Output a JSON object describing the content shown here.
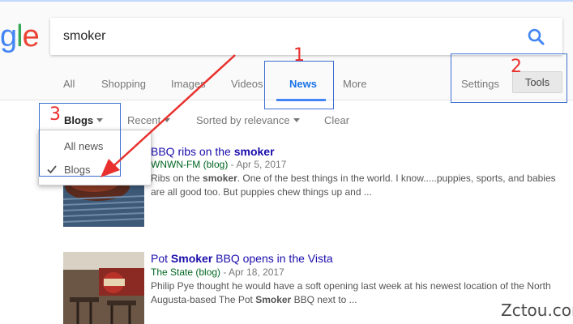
{
  "search": {
    "query": "smoker"
  },
  "logo_letters": {
    "g": "g",
    "l": "l",
    "e": "e"
  },
  "tabs": [
    {
      "label": "All"
    },
    {
      "label": "Shopping"
    },
    {
      "label": "Images"
    },
    {
      "label": "Videos"
    },
    {
      "label": "News"
    },
    {
      "label": "More"
    }
  ],
  "right_controls": {
    "settings": "Settings",
    "tools": "Tools"
  },
  "tools_bar": {
    "type": "Blogs",
    "time": "Recent",
    "sort": "Sorted by relevance",
    "clear": "Clear"
  },
  "type_dropdown": {
    "options": [
      "All news",
      "Blogs"
    ],
    "selected": "Blogs"
  },
  "results": [
    {
      "title_pre": "BBQ ribs on the ",
      "title_bold": "smoker",
      "title_post": "",
      "source": "WNWN-FM (blog)",
      "date": " - Apr 5, 2017",
      "snippet_1": "Ribs on the ",
      "snippet_bold": "smoker",
      "snippet_2": ". One of the best things in the world. I know.....puppies, sports, and babies are all good too. But puppies chew things up and ..."
    },
    {
      "title_pre": "Pot ",
      "title_bold": "Smoker",
      "title_post": " BBQ opens in the Vista",
      "source": "The State (blog)",
      "date": " - Apr 18, 2017",
      "snippet_1": "Philip Pye thought he would have a soft opening last week at his newest location of the North Augusta-based The Pot ",
      "snippet_bold": "Smoker",
      "snippet_2": " BBQ next to ..."
    }
  ],
  "annotations": [
    "1",
    "2",
    "3"
  ],
  "watermark": "Zctou.com",
  "colors": {
    "accent_blue": "#4285f4",
    "annotation_red": "#e8312e",
    "annotation_box_blue": "#3d6fd1",
    "link": "#1a0dab",
    "source_green": "#006621"
  }
}
